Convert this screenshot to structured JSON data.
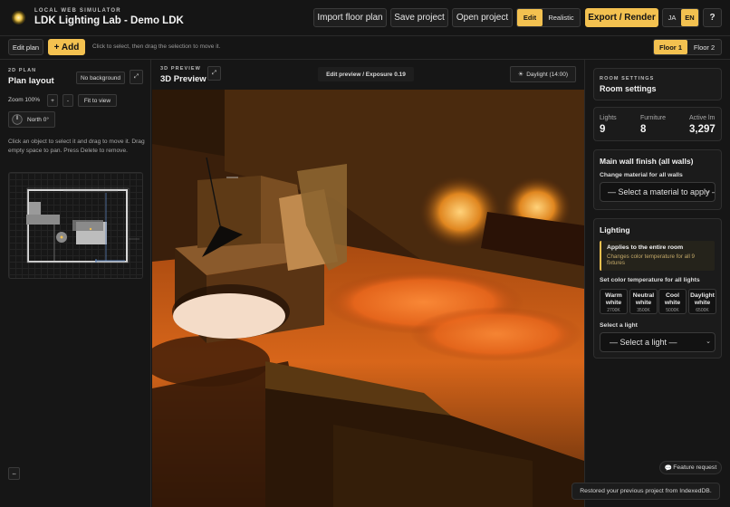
{
  "header": {
    "kicker": "LOCAL WEB SIMULATOR",
    "title": "LDK Lighting Lab - Demo LDK",
    "import_label": "Import floor plan",
    "save_label": "Save project",
    "open_label": "Open project",
    "mode_edit": "Edit",
    "mode_realistic": "Realistic",
    "export_label": "Export / Render",
    "lang_ja": "JA",
    "lang_en": "EN",
    "help_label": "?"
  },
  "toolbar": {
    "edit_plan": "Edit plan",
    "add_label": "+ Add",
    "hint": "Click to select, then drag the selection to move it.",
    "floor1": "Floor 1",
    "floor2": "Floor 2"
  },
  "plan": {
    "kicker": "2D PLAN",
    "title": "Plan layout",
    "no_background": "No background",
    "expand_icon": "⤢",
    "zoom_label": "Zoom 100%",
    "zoom_in": "+",
    "zoom_out": "-",
    "fit": "Fit to view",
    "north": "North 0°",
    "help": "Click an object to select it and drag to move it. Drag empty space to pan. Press Delete to remove.",
    "collapse_icon": "⇔"
  },
  "preview": {
    "kicker": "3D PREVIEW",
    "title": "3D Preview",
    "expand_icon": "⤢",
    "status": "Edit preview / Exposure 0.19",
    "daylight": "Daylight (14:00)"
  },
  "settings": {
    "kicker": "ROOM SETTINGS",
    "title": "Room settings",
    "stats": [
      {
        "label": "Lights",
        "value": "9"
      },
      {
        "label": "Furniture",
        "value": "8"
      },
      {
        "label": "Active lm",
        "value": "3,297"
      }
    ],
    "wall_title": "Main wall finish (all walls)",
    "wall_sub": "Change material for all walls",
    "wall_select": "— Select a material to apply —",
    "lighting_title": "Lighting",
    "notice_title": "Applies to the entire room",
    "notice_text": "Changes color temperature for all 9 fixtures",
    "temp_title": "Set color temperature for all lights",
    "temps": [
      {
        "name": "Warm white",
        "k": "2700K"
      },
      {
        "name": "Neutral white",
        "k": "3500K"
      },
      {
        "name": "Cool white",
        "k": "5000K"
      },
      {
        "name": "Daylight white",
        "k": "6500K"
      }
    ],
    "light_sub": "Select a light",
    "light_select": "— Select a light —"
  },
  "footer": {
    "feature": "Feature request",
    "toast": "Restored your previous project from IndexedDB."
  },
  "colors": {
    "accent": "#f3c150",
    "background": "#141414",
    "panel": "#1b1b1b"
  }
}
